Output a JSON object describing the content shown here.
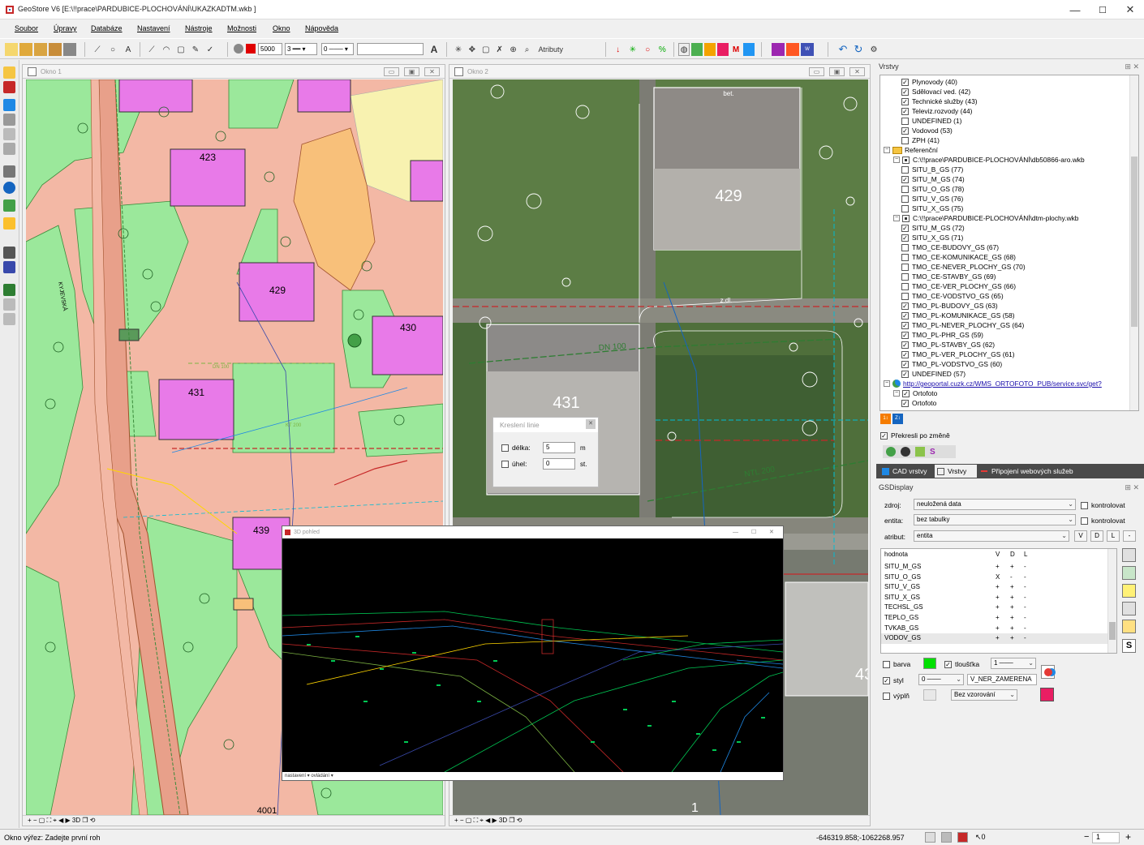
{
  "app": {
    "title": "GeoStore V6 [E:\\!!prace\\PARDUBICE-PLOCHOVÁNÍ\\UKAZKADTM.wkb ]",
    "min": "—",
    "max": "☐",
    "close": "✕"
  },
  "menu": [
    "Soubor",
    "Úpravy",
    "Databáze",
    "Nastavení",
    "Nástroje",
    "Možnosti",
    "Okno",
    "Nápověda"
  ],
  "toolbar": {
    "scale": "5000",
    "linewidth": "3",
    "linestyle": "0",
    "text_btn": "A",
    "atributy": "Atributy"
  },
  "window1": {
    "title": "Okno 1",
    "labels": {
      "b423": "423",
      "b429": "429",
      "b430": "430",
      "b431": "431",
      "b439": "439",
      "p4001": "4001",
      "street": "KYJEVSKÁ",
      "utility1": "DN 100",
      "utility2": "KT 200"
    }
  },
  "window2": {
    "title": "Okno 2",
    "labels": {
      "b429": "429",
      "b431": "431",
      "bet": "bet.",
      "zdl": "z.dl.",
      "dn100": "DN 100",
      "ntl200": "NTL 200",
      "n43": "43",
      "n1": "1"
    }
  },
  "map_footer": "+ − ▢ ⛶ ⌖ ◀ ▶ 3D ❐ ⟲",
  "dialog": {
    "title": "Kreslení linie",
    "close": "✕",
    "rows": [
      {
        "label": "délka:",
        "value": "5",
        "unit": "m"
      },
      {
        "label": "úhel:",
        "value": "0",
        "unit": "st."
      }
    ]
  },
  "view3d": {
    "title": "3D pohled",
    "bottom": "nastavení ▾  ovládání ▾",
    "min": "—",
    "max": "☐",
    "close": "✕"
  },
  "layers": {
    "title": "Vrstvy",
    "rows": [
      {
        "label": "Plynovody (40)",
        "indent": 2,
        "checked": true
      },
      {
        "label": "Sdělovací ved. (42)",
        "indent": 2,
        "checked": true
      },
      {
        "label": "Technické služby (43)",
        "indent": 2,
        "checked": true
      },
      {
        "label": "Televiz.rozvody (44)",
        "indent": 2,
        "checked": true
      },
      {
        "label": "UNDEFINED (1)",
        "indent": 2,
        "checked": false
      },
      {
        "label": "Vodovod (53)",
        "indent": 2,
        "checked": true
      },
      {
        "label": "ZPH (41)",
        "indent": 2,
        "checked": false
      },
      {
        "label": "Referenční",
        "indent": 0,
        "checked": null,
        "folder": true,
        "expand": "−"
      },
      {
        "label": "C:\\!!prace\\PARDUBICE-PLOCHOVÁNÍ\\db50866-aro.wkb",
        "indent": 1,
        "checked": false,
        "expand": "−",
        "partial": true
      },
      {
        "label": "SITU_B_GS (77)",
        "indent": 2,
        "checked": false
      },
      {
        "label": "SITU_M_GS (74)",
        "indent": 2,
        "checked": true
      },
      {
        "label": "SITU_O_GS (78)",
        "indent": 2,
        "checked": false
      },
      {
        "label": "SITU_V_GS (76)",
        "indent": 2,
        "checked": false
      },
      {
        "label": "SITU_X_GS (75)",
        "indent": 2,
        "checked": false
      },
      {
        "label": "C:\\!!prace\\PARDUBICE-PLOCHOVÁNÍ\\dtm-plochy.wkb",
        "indent": 1,
        "checked": false,
        "expand": "−",
        "partial": true
      },
      {
        "label": "SITU_M_GS (72)",
        "indent": 2,
        "checked": true
      },
      {
        "label": "SITU_X_GS (71)",
        "indent": 2,
        "checked": true
      },
      {
        "label": "TMO_CE-BUDOVY_GS (67)",
        "indent": 2,
        "checked": false
      },
      {
        "label": "TMO_CE-KOMUNIKACE_GS (68)",
        "indent": 2,
        "checked": false
      },
      {
        "label": "TMO_CE-NEVER_PLOCHY_GS (70)",
        "indent": 2,
        "checked": false
      },
      {
        "label": "TMO_CE-STAVBY_GS (69)",
        "indent": 2,
        "checked": false
      },
      {
        "label": "TMO_CE-VER_PLOCHY_GS (66)",
        "indent": 2,
        "checked": false
      },
      {
        "label": "TMO_CE-VODSTVO_GS (65)",
        "indent": 2,
        "checked": false
      },
      {
        "label": "TMO_PL-BUDOVY_GS (63)",
        "indent": 2,
        "checked": true
      },
      {
        "label": "TMO_PL-KOMUNIKACE_GS (58)",
        "indent": 2,
        "checked": true
      },
      {
        "label": "TMO_PL-NEVER_PLOCHY_GS (64)",
        "indent": 2,
        "checked": true
      },
      {
        "label": "TMO_PL-PHR_GS (59)",
        "indent": 2,
        "checked": true
      },
      {
        "label": "TMO_PL-STAVBY_GS (62)",
        "indent": 2,
        "checked": true
      },
      {
        "label": "TMO_PL-VER_PLOCHY_GS (61)",
        "indent": 2,
        "checked": true
      },
      {
        "label": "TMO_PL-VODSTVO_GS (60)",
        "indent": 2,
        "checked": true
      },
      {
        "label": "UNDEFINED (57)",
        "indent": 2,
        "checked": true
      },
      {
        "label": "http://geoportal.cuzk.cz/WMS_ORTOFOTO_PUB/service.svc/get?",
        "indent": 0,
        "checked": null,
        "globe": true,
        "link": true,
        "expand": "−"
      },
      {
        "label": "Ortofoto",
        "indent": 1,
        "checked": true,
        "expand": "−"
      },
      {
        "label": "Ortofoto",
        "indent": 2,
        "checked": true
      }
    ],
    "redraw": "Překresli po změně"
  },
  "tabs": [
    "CAD vrstvy",
    "Vrstvy",
    "Připojení webových služeb"
  ],
  "gsdisplay": {
    "title": "GSDisplay",
    "zdroj_label": "zdroj:",
    "zdroj": "neuložená data",
    "entita_label": "entita:",
    "entita": "bez tabulky",
    "atribut_label": "atribut:",
    "atribut": "entita",
    "kontrolovat": "kontrolovat",
    "btns": [
      "V",
      "D",
      "L",
      "-"
    ],
    "headers": [
      "hodnota",
      "V",
      "D",
      "L"
    ],
    "rows": [
      [
        "SITU_M_GS",
        "+",
        "+",
        "-"
      ],
      [
        "SITU_O_GS",
        "X",
        "-",
        "-"
      ],
      [
        "SITU_V_GS",
        "+",
        "+",
        "-"
      ],
      [
        "SITU_X_GS",
        "+",
        "+",
        "-"
      ],
      [
        "TECHSL_GS",
        "+",
        "+",
        "-"
      ],
      [
        "TEPLO_GS",
        "+",
        "+",
        "-"
      ],
      [
        "TVKAB_GS",
        "+",
        "+",
        "-"
      ],
      [
        "VODOV_GS",
        "+",
        "+",
        "-"
      ]
    ],
    "barva": "barva",
    "tloustka": "tloušťka",
    "tloustka_val": "1",
    "styl": "styl",
    "styl_val": "0",
    "styl_name": "V_NER_ZAMERENA",
    "vypln": "výplň",
    "vypln_val": "Bez vzorování",
    "barva_color": "#00e000"
  },
  "status": {
    "text": "Okno výřez: Zadejte první roh",
    "coords": "-646319.858;-1062268.957",
    "num0": "0",
    "page": "1"
  }
}
